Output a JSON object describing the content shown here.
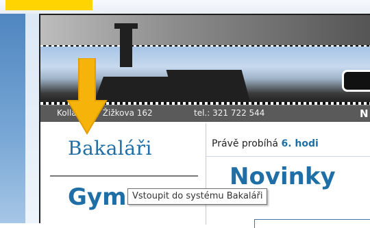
{
  "header": {
    "address": "Kollárova / Žižkova 162",
    "phone": "tel.: 321 722 544",
    "corner_text": "N"
  },
  "nav": {
    "bakalari_label": "Bakaláři",
    "gym_label": "Gym"
  },
  "content": {
    "notice_prefix": "Právě probíhá",
    "notice_highlight": "6. hodi",
    "heading": "Novinky"
  },
  "tooltip": {
    "text": "Vstoupit do systému Bakaláři"
  },
  "colors": {
    "accent": "#1f6fa6",
    "highlight": "#ffd400",
    "arrow": "#f6b40a"
  }
}
